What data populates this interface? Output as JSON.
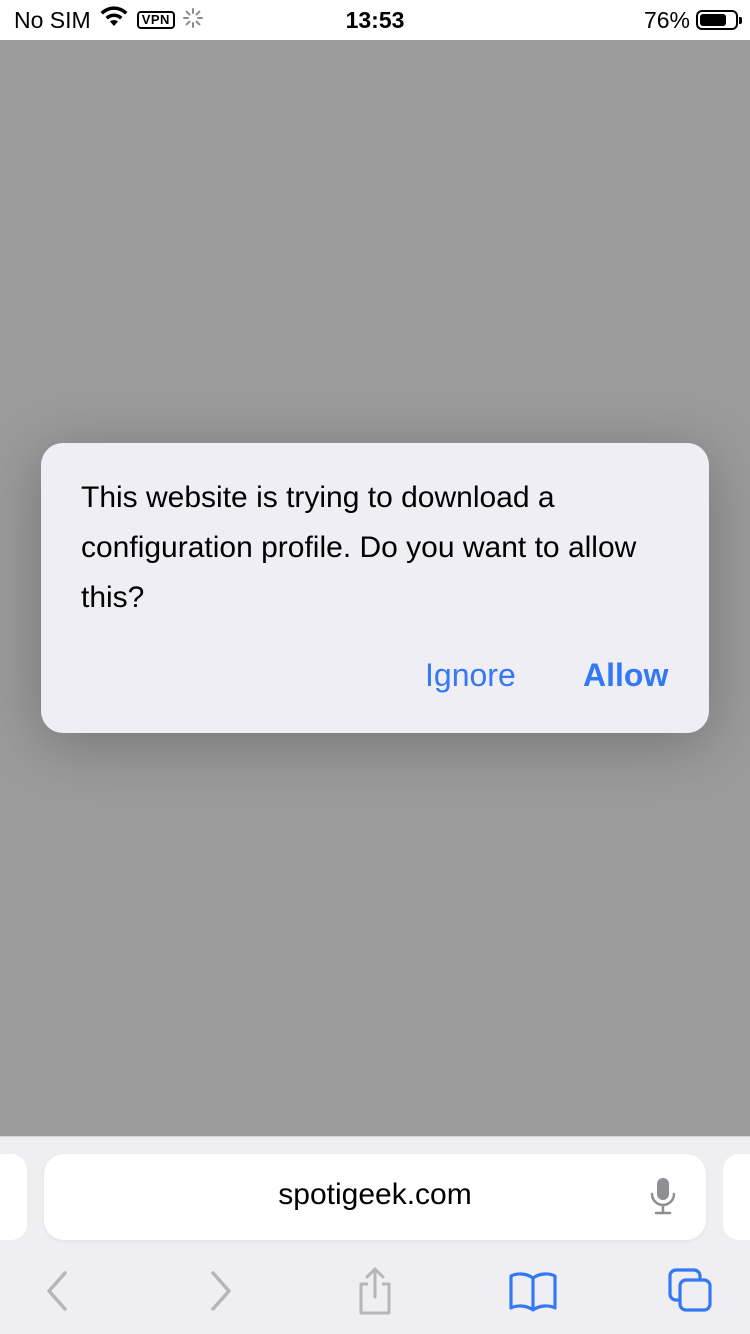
{
  "status_bar": {
    "carrier": "No SIM",
    "vpn_label": "VPN",
    "time": "13:53",
    "battery_percent_label": "76%",
    "battery_level": 0.76
  },
  "alert": {
    "message": "This website is trying to download a configuration profile. Do you want to allow this?",
    "ignore_label": "Ignore",
    "allow_label": "Allow"
  },
  "browser": {
    "address": "spotigeek.com"
  },
  "toolbar": {
    "icons": [
      "back-icon",
      "forward-icon",
      "share-icon",
      "bookmarks-icon",
      "tabs-icon"
    ]
  },
  "colors": {
    "accent": "#3478f6",
    "dim_overlay": "#9b9b9b",
    "alert_bg": "#efeef4",
    "disabled_icon": "#b5b5ba"
  }
}
